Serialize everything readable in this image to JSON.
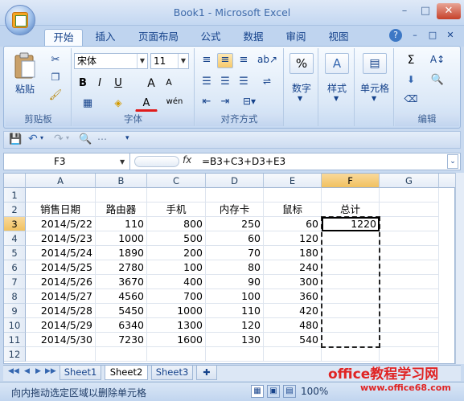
{
  "window": {
    "title": "Book1 - Microsoft Excel",
    "min": "–",
    "max": "□",
    "close": "✕"
  },
  "ribbon_tabs": [
    "开始",
    "插入",
    "页面布局",
    "公式",
    "数据",
    "审阅",
    "视图"
  ],
  "ribbon": {
    "clipboard": {
      "paste": "粘贴",
      "label": "剪贴板"
    },
    "font": {
      "name": "宋体",
      "size": "11",
      "bold": "B",
      "italic": "I",
      "underline": "U",
      "grow": "A",
      "shrink": "A",
      "color_letter": "A",
      "wen": "wén",
      "label": "字体"
    },
    "alignment": {
      "label": "对齐方式"
    },
    "number": {
      "percent": "%",
      "label": "数字"
    },
    "styles": {
      "label": "样式"
    },
    "cells": {
      "label": "单元格"
    },
    "editing": {
      "sigma": "Σ",
      "label": "编辑"
    }
  },
  "formula_bar": {
    "name_box": "F3",
    "fx": "fx",
    "formula": "=B3+C3+D3+E3"
  },
  "columns": [
    "A",
    "B",
    "C",
    "D",
    "E",
    "F",
    "G"
  ],
  "rows": [
    "1",
    "2",
    "3",
    "4",
    "5",
    "6",
    "7",
    "8",
    "9",
    "10",
    "11",
    "12"
  ],
  "selected_cell": "F3",
  "table": {
    "headers": [
      "销售日期",
      "路由器",
      "手机",
      "内存卡",
      "鼠标",
      "总计"
    ],
    "data": [
      [
        "2014/5/22",
        "110",
        "800",
        "250",
        "60",
        "1220"
      ],
      [
        "2014/5/23",
        "1000",
        "500",
        "60",
        "120",
        ""
      ],
      [
        "2014/5/24",
        "1890",
        "200",
        "70",
        "180",
        ""
      ],
      [
        "2014/5/25",
        "2780",
        "100",
        "80",
        "240",
        ""
      ],
      [
        "2014/5/26",
        "3670",
        "400",
        "90",
        "300",
        ""
      ],
      [
        "2014/5/27",
        "4560",
        "700",
        "100",
        "360",
        ""
      ],
      [
        "2014/5/28",
        "5450",
        "1000",
        "110",
        "420",
        ""
      ],
      [
        "2014/5/29",
        "6340",
        "1300",
        "120",
        "480",
        ""
      ],
      [
        "2014/5/30",
        "7230",
        "1600",
        "130",
        "540",
        ""
      ]
    ]
  },
  "sheets": [
    "Sheet1",
    "Sheet2",
    "Sheet3"
  ],
  "active_sheet": "Sheet2",
  "status": {
    "message": "向内拖动选定区域以删除单元格",
    "zoom": "100%"
  },
  "watermark": {
    "line1": "office教程学习网",
    "line2": "www.office68.com"
  }
}
